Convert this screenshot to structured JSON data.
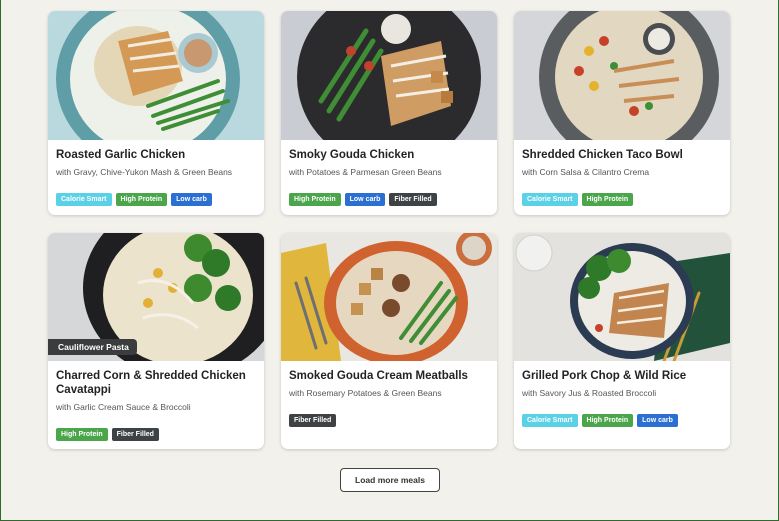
{
  "meals": [
    {
      "title": "Roasted Garlic Chicken",
      "subtitle": "with Gravy, Chive-Yukon Mash & Green Beans",
      "tags": [
        {
          "label": "Calorie Smart",
          "kind": "calorie"
        },
        {
          "label": "High Protein",
          "kind": "protein"
        },
        {
          "label": "Low carb",
          "kind": "lowcarb"
        }
      ],
      "image_icon": "roasted-garlic-chicken-photo"
    },
    {
      "title": "Smoky Gouda Chicken",
      "subtitle": "with Potatoes & Parmesan Green Beans",
      "tags": [
        {
          "label": "High Protein",
          "kind": "protein"
        },
        {
          "label": "Low carb",
          "kind": "lowcarb"
        },
        {
          "label": "Fiber Filled",
          "kind": "fiber"
        }
      ],
      "image_icon": "smoky-gouda-chicken-photo"
    },
    {
      "title": "Shredded Chicken Taco Bowl",
      "subtitle": "with Corn Salsa & Cilantro Crema",
      "tags": [
        {
          "label": "Calorie Smart",
          "kind": "calorie"
        },
        {
          "label": "High Protein",
          "kind": "protein"
        }
      ],
      "image_icon": "taco-bowl-photo"
    },
    {
      "title": "Charred Corn & Shredded Chicken Cavatappi",
      "subtitle": "with Garlic Cream Sauce & Broccoli",
      "overlay_tag": "Cauliflower Pasta",
      "tags": [
        {
          "label": "High Protein",
          "kind": "protein"
        },
        {
          "label": "Fiber Filled",
          "kind": "fiber"
        }
      ],
      "image_icon": "cavatappi-photo"
    },
    {
      "title": "Smoked Gouda Cream Meatballs",
      "subtitle": "with Rosemary Potatoes & Green Beans",
      "tags": [
        {
          "label": "Fiber Filled",
          "kind": "fiber"
        }
      ],
      "image_icon": "meatballs-photo"
    },
    {
      "title": "Grilled Pork Chop & Wild Rice",
      "subtitle": "with Savory Jus & Roasted Broccoli",
      "tags": [
        {
          "label": "Calorie Smart",
          "kind": "calorie"
        },
        {
          "label": "High Protein",
          "kind": "protein"
        },
        {
          "label": "Low carb",
          "kind": "lowcarb"
        }
      ],
      "image_icon": "pork-chop-photo"
    }
  ],
  "load_more_label": "Load more meals",
  "colors": {
    "calorie_smart": "#5bd1e8",
    "high_protein": "#4ba54b",
    "low_carb": "#2a6fd1",
    "fiber_filled": "#3f4245",
    "page_bg": "#f2f1ec"
  }
}
